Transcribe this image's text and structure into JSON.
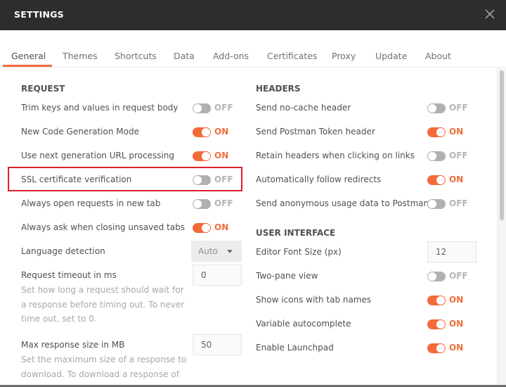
{
  "window": {
    "title": "SETTINGS",
    "close_icon": "close-icon"
  },
  "tabs": [
    {
      "label": "General",
      "active": true
    },
    {
      "label": "Themes",
      "active": false
    },
    {
      "label": "Shortcuts",
      "active": false
    },
    {
      "label": "Data",
      "active": false
    },
    {
      "label": "Add-ons",
      "active": false
    },
    {
      "label": "Certificates",
      "active": false
    },
    {
      "label": "Proxy",
      "active": false
    },
    {
      "label": "Update",
      "active": false
    },
    {
      "label": "About",
      "active": false
    }
  ],
  "request": {
    "title": "REQUEST",
    "toggles": [
      {
        "label": "Trim keys and values in request body",
        "state": "OFF"
      },
      {
        "label": "New Code Generation Mode",
        "state": "ON"
      },
      {
        "label": "Use next generation URL processing",
        "state": "ON"
      },
      {
        "label": "SSL certificate verification",
        "state": "OFF"
      },
      {
        "label": "Always open requests in new tab",
        "state": "OFF"
      },
      {
        "label": "Always ask when closing unsaved tabs",
        "state": "ON"
      }
    ],
    "language_detection": {
      "label": "Language detection",
      "value": "Auto"
    },
    "timeout": {
      "label": "Request timeout in ms",
      "value": "0",
      "help": "Set how long a request should wait for a response before timing out. To never time out, set to 0."
    },
    "max_response": {
      "label": "Max response size in MB",
      "value": "50",
      "help": "Set the maximum size of a response to download. To download a response of"
    }
  },
  "headers": {
    "title": "HEADERS",
    "toggles": [
      {
        "label": "Send no-cache header",
        "state": "OFF"
      },
      {
        "label": "Send Postman Token header",
        "state": "ON"
      },
      {
        "label": "Retain headers when clicking on links",
        "state": "OFF"
      },
      {
        "label": "Automatically follow redirects",
        "state": "ON"
      },
      {
        "label": "Send anonymous usage data to Postman",
        "state": "OFF"
      }
    ]
  },
  "user_interface": {
    "title": "USER INTERFACE",
    "editor_font_size": {
      "label": "Editor Font Size (px)",
      "value": "12"
    },
    "toggles": [
      {
        "label": "Two-pane view",
        "state": "OFF"
      },
      {
        "label": "Show icons with tab names",
        "state": "ON"
      },
      {
        "label": "Variable autocomplete",
        "state": "ON"
      },
      {
        "label": "Enable Launchpad",
        "state": "ON"
      }
    ]
  },
  "colors": {
    "accent": "#f26b3a",
    "highlight_box": "#e0202a",
    "titlebar": "#2d2d2d"
  }
}
